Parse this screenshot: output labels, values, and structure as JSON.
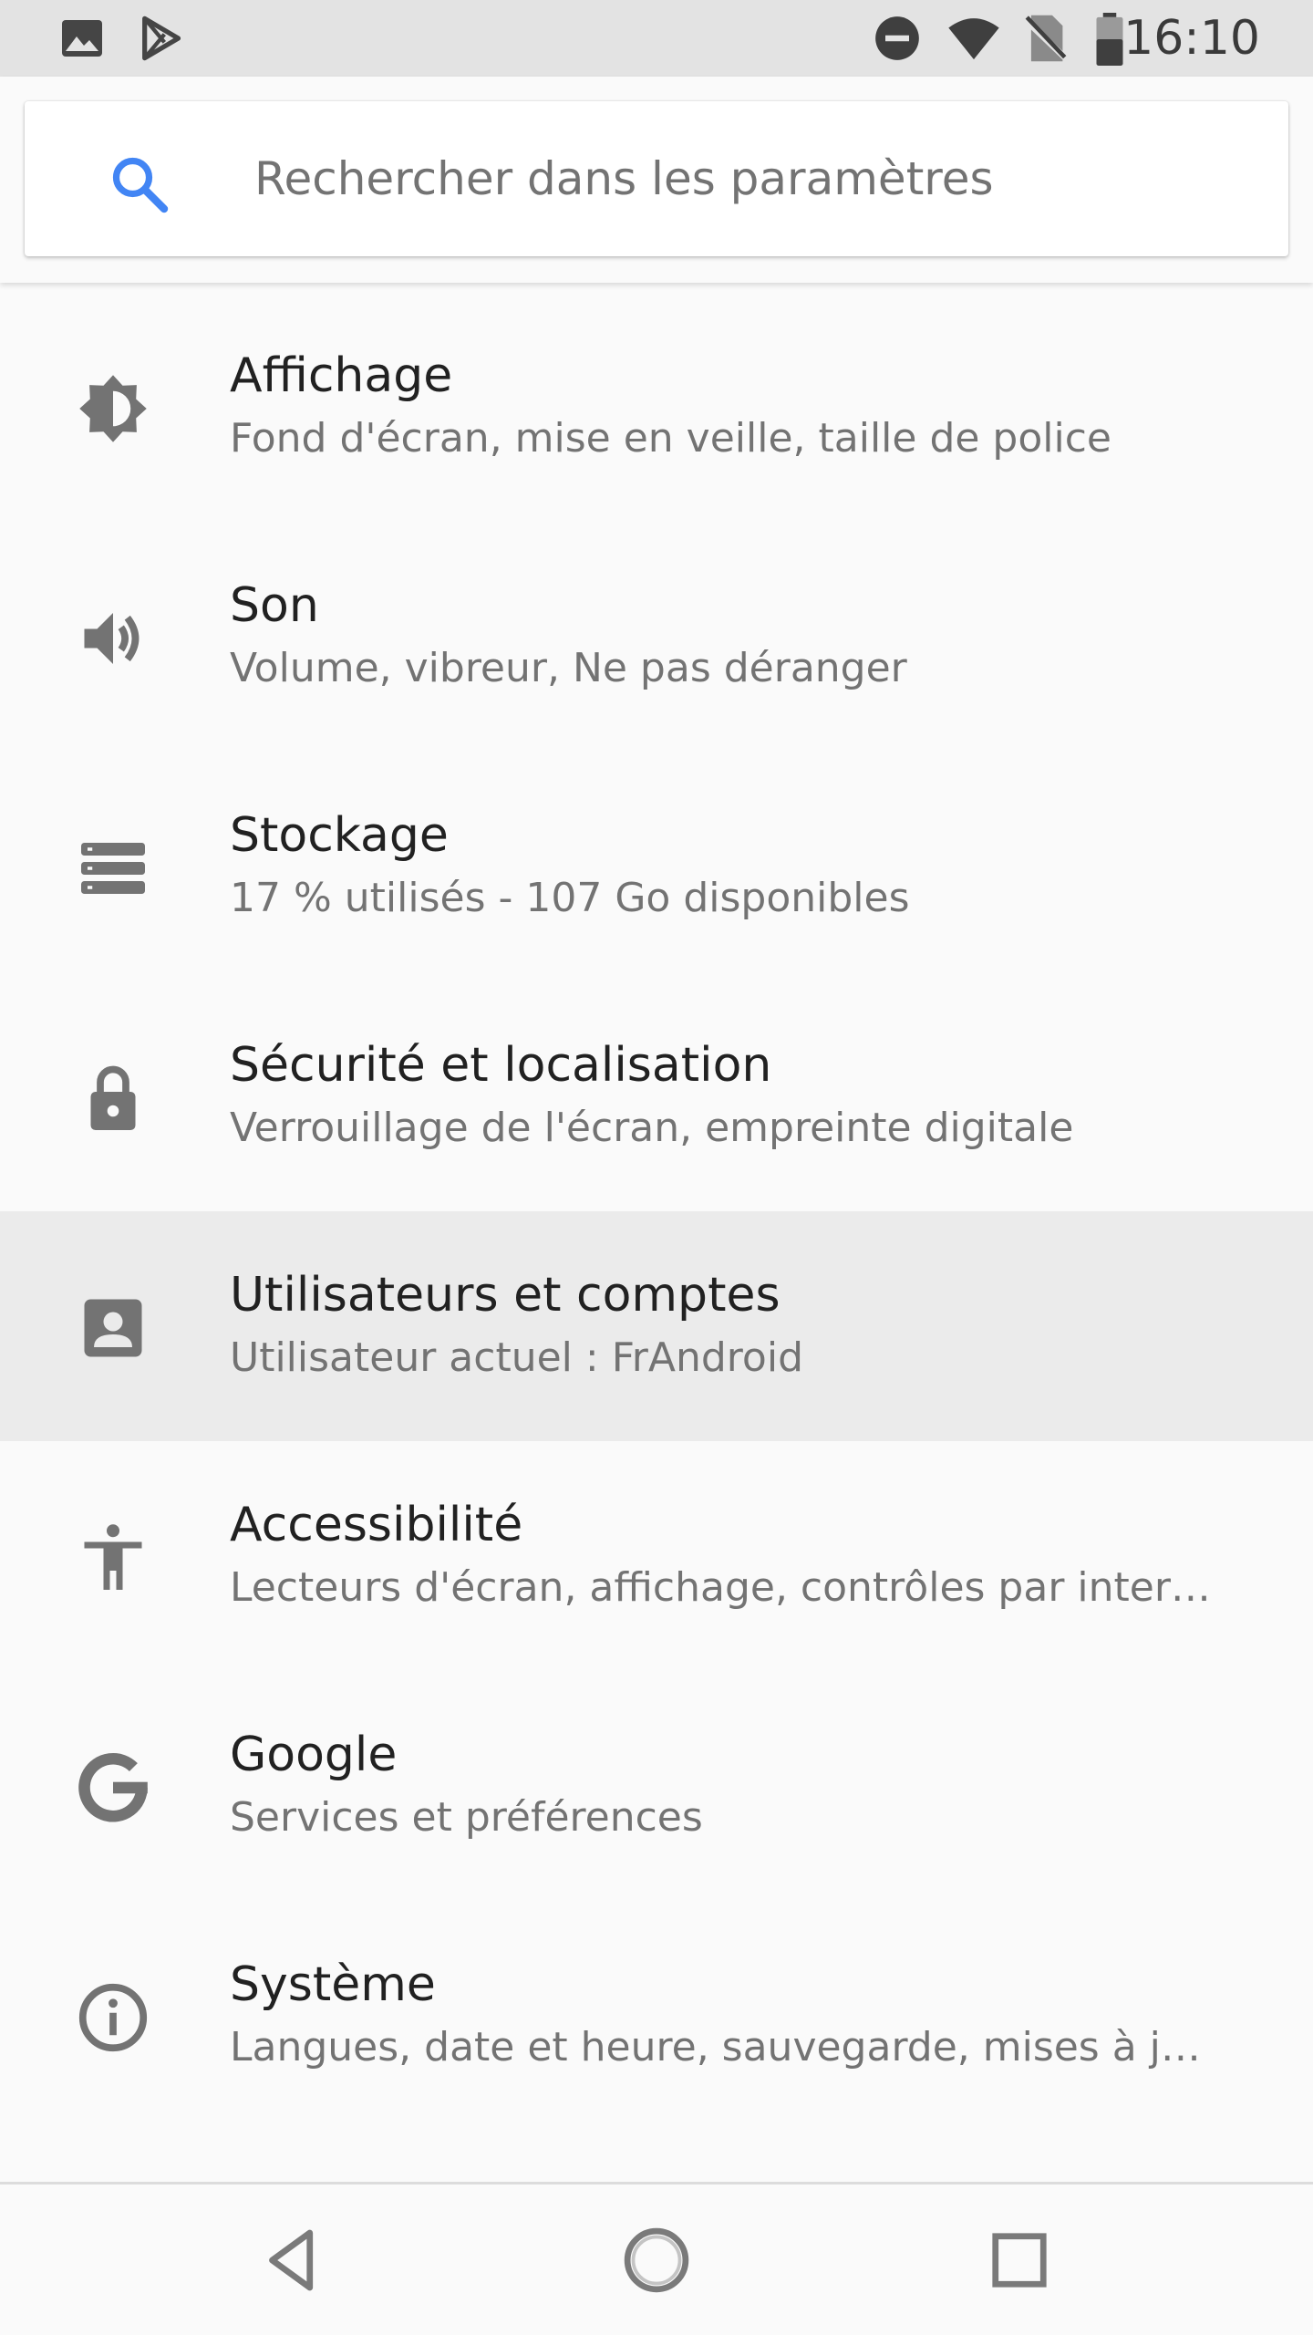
{
  "status_bar": {
    "time": "16:10",
    "left_icons": [
      "image-icon",
      "play-store-icon"
    ],
    "right_icons": [
      "do-not-disturb-icon",
      "wifi-icon",
      "no-sim-icon",
      "battery-icon"
    ]
  },
  "search": {
    "placeholder": "Rechercher dans les paramètres",
    "value": ""
  },
  "settings": {
    "items": [
      {
        "icon": "brightness-icon",
        "title": "Affichage",
        "summary": "Fond d'écran, mise en veille, taille de police"
      },
      {
        "icon": "volume-icon",
        "title": "Son",
        "summary": "Volume, vibreur, Ne pas déranger"
      },
      {
        "icon": "storage-icon",
        "title": "Stockage",
        "summary": "17 % utilisés - 107 Go disponibles"
      },
      {
        "icon": "lock-icon",
        "title": "Sécurité et localisation",
        "summary": "Verrouillage de l'écran, empreinte digitale"
      },
      {
        "icon": "account-box-icon",
        "title": "Utilisateurs et comptes",
        "summary": "Utilisateur actuel : FrAndroid",
        "highlighted": true
      },
      {
        "icon": "accessibility-icon",
        "title": "Accessibilité",
        "summary": "Lecteurs d'écran, affichage, contrôles par interac…"
      },
      {
        "icon": "google-icon",
        "title": "Google",
        "summary": "Services et préférences"
      },
      {
        "icon": "info-icon",
        "title": "Système",
        "summary": "Langues, date et heure, sauvegarde, mises à jour"
      }
    ]
  },
  "nav_bar": {
    "buttons": [
      "back-icon",
      "home-icon",
      "recents-icon"
    ]
  },
  "colors": {
    "status_bar_bg": "#e3e3e3",
    "background": "#fafafa",
    "highlight": "#ebebeb",
    "title_text": "#212121",
    "summary_text": "#737373",
    "icon": "#737373",
    "search_accent": "#4285f4"
  }
}
